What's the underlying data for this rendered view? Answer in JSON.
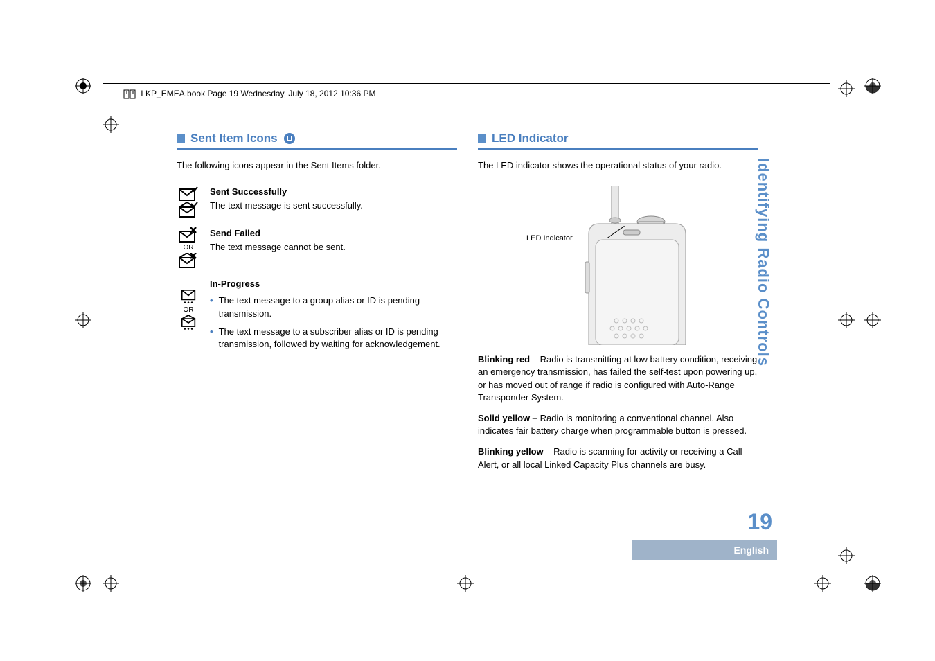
{
  "header": "LKP_EMEA.book  Page 19  Wednesday, July 18, 2012  10:36 PM",
  "left": {
    "title": "Sent Item Icons",
    "intro": "The following icons appear in the Sent Items folder.",
    "items": [
      {
        "heading": "Sent Successfully",
        "body": "The text message is sent successfully."
      },
      {
        "heading": "Send Failed",
        "body": "The text message cannot be sent.",
        "or": "OR"
      },
      {
        "heading": "In-Progress",
        "or": "OR",
        "bullets": [
          "The text message to a group alias or ID is pending transmission.",
          "The text message to a subscriber alias or ID is pending transmission, followed by waiting for acknowledgement."
        ]
      }
    ]
  },
  "right": {
    "title": "LED Indicator",
    "intro": "The LED indicator shows the operational status of your radio.",
    "figLabel": "LED Indicator",
    "paras": [
      {
        "lead": "Blinking red",
        "body": "Radio is transmitting at low battery condition, receiving an emergency transmission, has failed the self-test upon powering up, or has moved out of range if radio is configured with Auto-Range Transponder System."
      },
      {
        "lead": "Solid yellow",
        "body": "Radio is monitoring a conventional channel. Also indicates fair battery charge when programmable button is pressed."
      },
      {
        "lead": "Blinking yellow",
        "body": "Radio is scanning for activity or receiving a Call Alert, or all local Linked Capacity Plus channels are busy."
      }
    ]
  },
  "sideTitle": "Identifying Radio Controls",
  "pageNumber": "19",
  "language": "English",
  "dash": " – "
}
